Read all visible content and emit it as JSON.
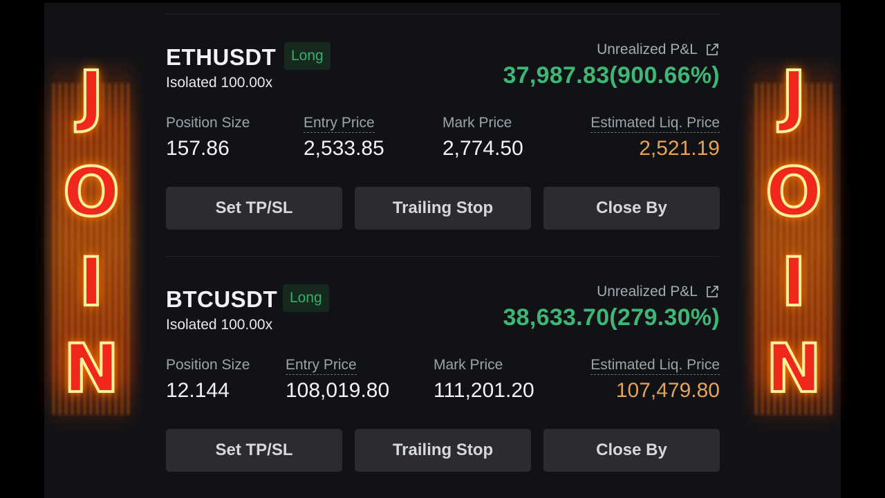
{
  "overlay": {
    "letters": [
      "J",
      "O",
      "I",
      "N"
    ]
  },
  "positions": [
    {
      "symbol": "ETHUSDT",
      "side": "Long",
      "margin_mode": "Isolated 100.00x",
      "pnl_label": "Unrealized P&L",
      "pnl_value": "37,987.83(900.66%)",
      "position_size_label": "Position Size",
      "position_size": "157.86",
      "entry_price_label": "Entry Price",
      "entry_price": "2,533.85",
      "mark_price_label": "Mark Price",
      "mark_price": "2,774.50",
      "liq_price_label": "Estimated Liq. Price",
      "liq_price": "2,521.19",
      "buttons": [
        "Set TP/SL",
        "Trailing Stop",
        "Close By"
      ]
    },
    {
      "symbol": "BTCUSDT",
      "side": "Long",
      "margin_mode": "Isolated 100.00x",
      "pnl_label": "Unrealized P&L",
      "pnl_value": "38,633.70(279.30%)",
      "position_size_label": "Position Size",
      "position_size": "12.144",
      "entry_price_label": "Entry Price",
      "entry_price": "108,019.80",
      "mark_price_label": "Mark Price",
      "mark_price": "111,201.20",
      "liq_price_label": "Estimated Liq. Price",
      "liq_price": "107,479.80",
      "buttons": [
        "Set TP/SL",
        "Trailing Stop",
        "Close By"
      ]
    }
  ],
  "colors": {
    "background": "#111216",
    "profit_green": "#3fb675",
    "liq_orange": "#e5a35a",
    "badge_bg": "#16291f",
    "button_bg": "#2a2c31"
  },
  "icons": {
    "pnl_share": "external-link-icon"
  }
}
